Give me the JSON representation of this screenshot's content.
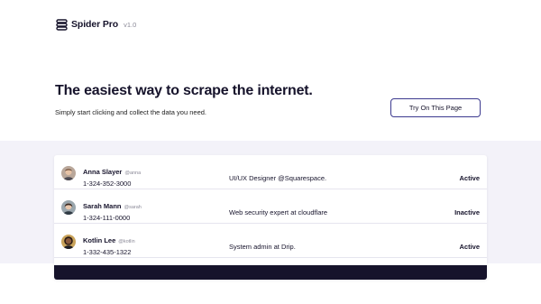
{
  "app": {
    "name": "Spider Pro",
    "version": "v1.0"
  },
  "hero": {
    "title": "The easiest way to scrape the internet.",
    "subtitle": "Simply start clicking and collect the data you need.",
    "cta_label": "Try On This Page"
  },
  "icons": {
    "logo": "spider-logo-icon"
  },
  "colors": {
    "accent": "#3c3a8f",
    "dark": "#16132b",
    "band": "#f3f2f9"
  },
  "users": [
    {
      "name": "Anna Slayer",
      "handle": "@anna",
      "phone": "1-324-352-3000",
      "role": "UI/UX Designer @Squarespace.",
      "status": "Active"
    },
    {
      "name": "Sarah Mann",
      "handle": "@sarah",
      "phone": "1-324-111-0000",
      "role": "Web security expert at cloudflare",
      "status": "Inactive"
    },
    {
      "name": "Kotlin Lee",
      "handle": "@kotlin",
      "phone": "1-332-435-1322",
      "role": "System admin at Drip.",
      "status": "Active"
    }
  ]
}
